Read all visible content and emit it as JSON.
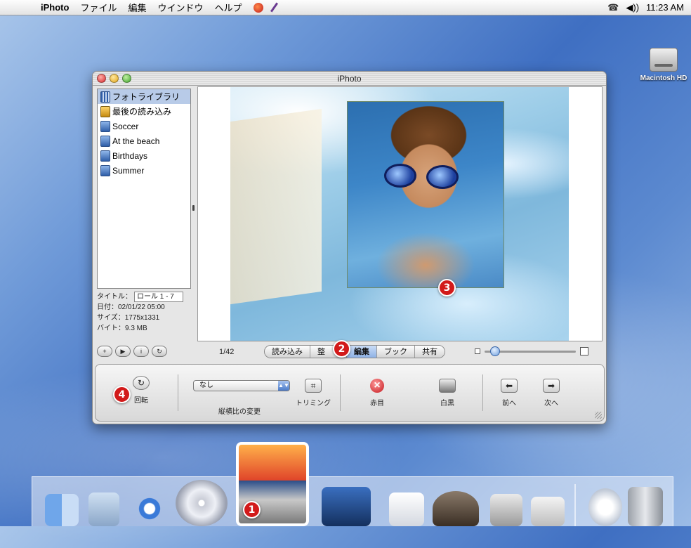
{
  "menubar": {
    "app": "iPhoto",
    "items": [
      "ファイル",
      "編集",
      "ウインドウ",
      "ヘルプ"
    ],
    "time": "11:23 AM",
    "volume_icon": "◀))"
  },
  "desktop": {
    "hd_label": "Macintosh HD"
  },
  "window": {
    "title": "iPhoto",
    "sources": [
      {
        "label": "フォトライブラリ",
        "kind": "library-icon",
        "selected": true
      },
      {
        "label": "最後の読み込み",
        "kind": "roll-icon"
      },
      {
        "label": "Soccer",
        "kind": "album-icon"
      },
      {
        "label": "At the beach",
        "kind": "album-icon"
      },
      {
        "label": "Birthdays",
        "kind": "album-icon"
      },
      {
        "label": "Summer",
        "kind": "album-icon"
      }
    ],
    "info": {
      "title_label": "タイトル：",
      "title_value": "ロール 1 - 7",
      "date": "日付：02/01/22 05:00",
      "size": "サイズ：1775x1331",
      "bytes": "バイト：9.3 MB"
    },
    "counter": "1/42",
    "left_buttons": [
      "+",
      "▶",
      "i",
      "↻"
    ],
    "modes": [
      {
        "label": "読み込み"
      },
      {
        "label": "整"
      },
      {
        "label": "編集",
        "active": true
      },
      {
        "label": "ブック"
      },
      {
        "label": "共有"
      }
    ],
    "edit": {
      "rotate": "回転",
      "aspect_value": "なし",
      "aspect_label": "縦横比の変更",
      "crop": "トリミング",
      "redeye": "赤目",
      "bw": "白黒",
      "prev": "前へ",
      "next": "次へ"
    }
  },
  "badges": [
    "1",
    "2",
    "3",
    "4"
  ]
}
